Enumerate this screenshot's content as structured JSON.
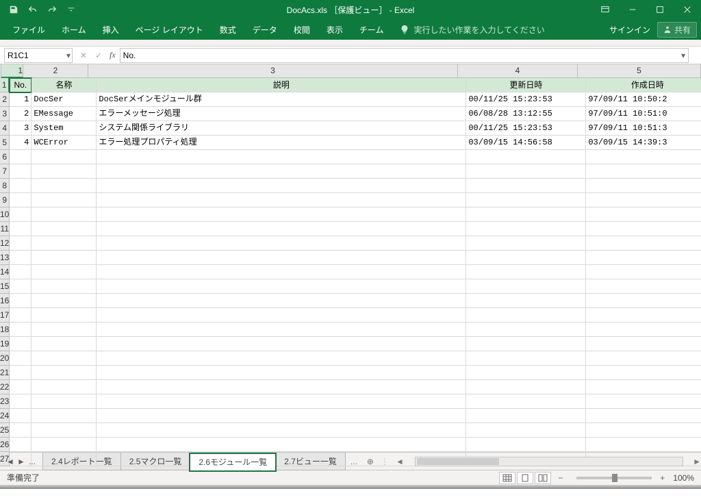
{
  "titlebar": {
    "title": "DocAcs.xls ［保護ビュー］ - Excel"
  },
  "ribbon": {
    "tabs": [
      "ファイル",
      "ホーム",
      "挿入",
      "ページ レイアウト",
      "数式",
      "データ",
      "校閲",
      "表示",
      "チーム"
    ],
    "tellme": "実行したい作業を入力してください",
    "signin": "サインイン",
    "share": "共有"
  },
  "formula": {
    "namebox": "R1C1",
    "value": "No."
  },
  "columns": {
    "labels": [
      "1",
      "2",
      "3",
      "4",
      "5"
    ],
    "widths": [
      32,
      95,
      540,
      175,
      180
    ]
  },
  "rows": {
    "count": 27
  },
  "sheet": {
    "headers": [
      "No.",
      "名称",
      "説明",
      "更新日時",
      "作成日時"
    ],
    "data": [
      {
        "no": "1",
        "name": "DocSer",
        "desc": "DocSerメインモジュール群",
        "upd": "00/11/25 15:23:53",
        "crt": "97/09/11 10:50:2"
      },
      {
        "no": "2",
        "name": "EMessage",
        "desc": "エラーメッセージ処理",
        "upd": "06/08/28 13:12:55",
        "crt": "97/09/11 10:51:0"
      },
      {
        "no": "3",
        "name": "System",
        "desc": "システム関係ライブラリ",
        "upd": "00/11/25 15:23:53",
        "crt": "97/09/11 10:51:3"
      },
      {
        "no": "4",
        "name": "WCError",
        "desc": "エラー処理プロパティ処理",
        "upd": "03/09/15 14:56:58",
        "crt": "03/09/15 14:39:3"
      }
    ]
  },
  "tabs": {
    "ellipsis": "...",
    "items": [
      "2.4レポート一覧",
      "2.5マクロ一覧",
      "2.6モジュール一覧",
      "2.7ビュー一覧"
    ],
    "active": 2,
    "new": "⊕"
  },
  "status": {
    "ready": "準備完了",
    "zoom": "100%"
  }
}
